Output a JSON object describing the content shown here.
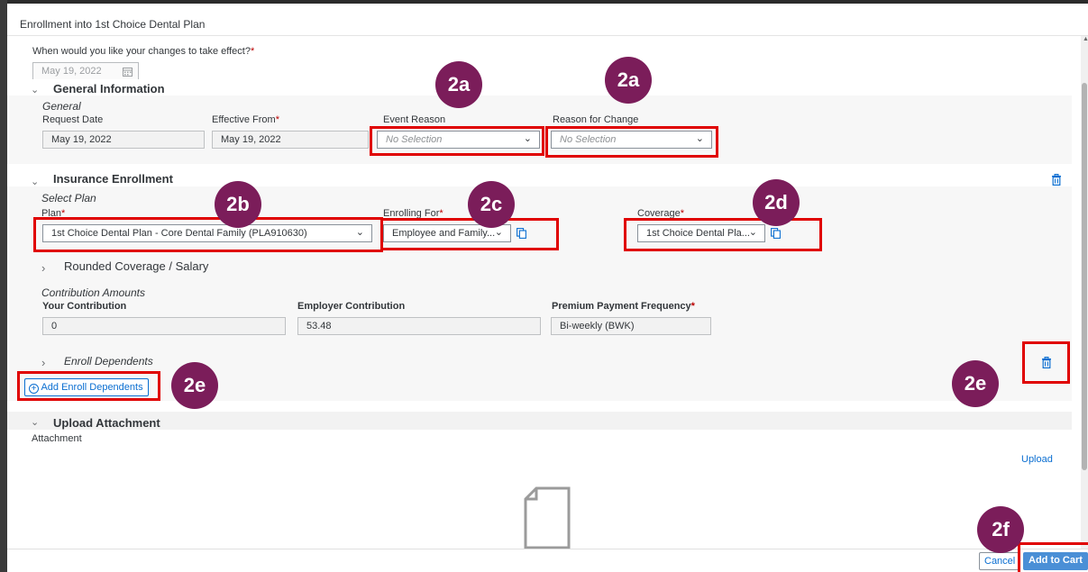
{
  "dialog": {
    "title": "Enrollment into 1st Choice Dental Plan"
  },
  "effective_question": {
    "label": "When would you like your changes to take effect?",
    "required_mark": "*",
    "date": "May 19, 2022"
  },
  "general_info": {
    "header": "General Information",
    "group_title": "General",
    "request_date_label": "Request Date",
    "request_date": "May 19, 2022",
    "effective_from_label": "Effective From",
    "effective_from": "May 19, 2022",
    "event_reason_label": "Event Reason",
    "event_reason_placeholder": "No Selection",
    "reason_change_label": "Reason for Change",
    "reason_change_placeholder": "No Selection"
  },
  "insurance": {
    "header": "Insurance Enrollment",
    "group_title": "Select Plan",
    "plan_label": "Plan",
    "plan_value": "1st Choice Dental Plan - Core Dental Family (PLA910630)",
    "enrolling_label": "Enrolling For",
    "enrolling_value": "Employee and Family...",
    "coverage_label": "Coverage",
    "coverage_value": "1st Choice Dental Pla...",
    "rounded_label": "Rounded Coverage / Salary",
    "contrib_title": "Contribution Amounts",
    "your_contrib_label": "Your Contribution",
    "your_contrib_value": "0",
    "employer_contrib_label": "Employer Contribution",
    "employer_contrib_value": "53.48",
    "freq_label": "Premium Payment Frequency",
    "freq_value": "Bi-weekly (BWK)",
    "dependents_label": "Enroll Dependents",
    "add_dependents_label": "Add Enroll Dependents"
  },
  "upload": {
    "header": "Upload Attachment",
    "attachment_label": "Attachment",
    "upload_link": "Upload"
  },
  "footer": {
    "cancel": "Cancel",
    "add_to_cart": "Add to Cart"
  },
  "callouts": {
    "a1": "2a",
    "a2": "2a",
    "b": "2b",
    "c": "2c",
    "d": "2d",
    "e1": "2e",
    "e2": "2e",
    "f": "2f"
  },
  "colors": {
    "callout_bg": "#7b1d5a",
    "highlight": "#e00000",
    "primary": "#0a6ed1",
    "required": "#bb0000"
  }
}
